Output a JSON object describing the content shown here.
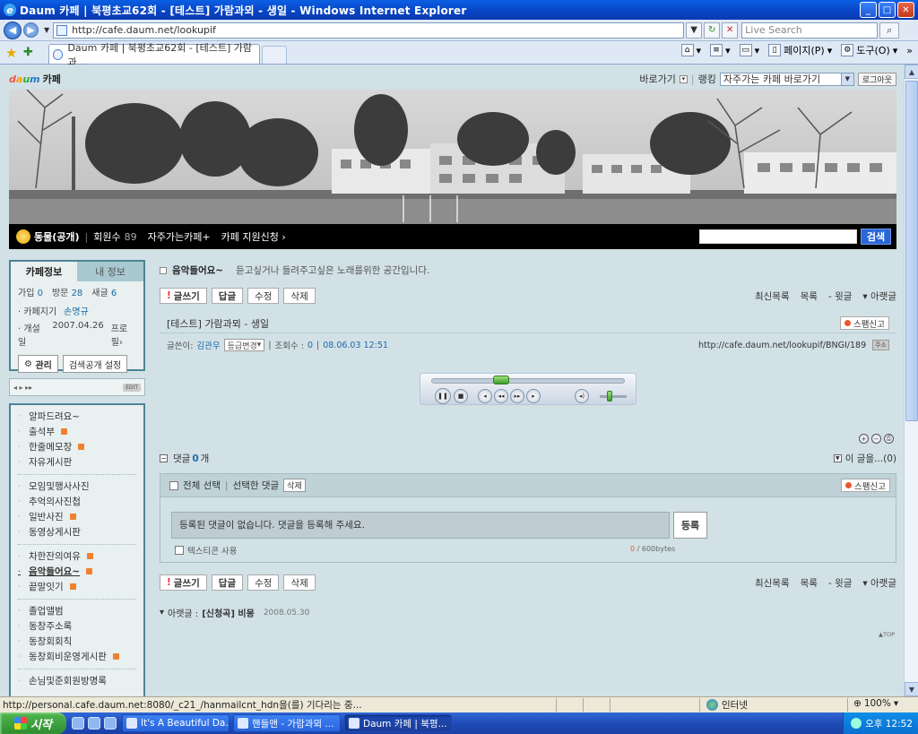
{
  "browser": {
    "window_title": "Daum 카페 | 북평초교62회 - [테스트] 가람과뫼 - 생일 - Windows Internet Explorer",
    "address": "http://cafe.daum.net/lookupif",
    "search_placeholder": "Live Search",
    "tab_title": "Daum 카페 | 북평초교62회 - [테스트] 가람과...",
    "cmd_page": "페이지(P)",
    "cmd_tools": "도구(O)",
    "cmd_more": "»",
    "status_text": "http://personal.cafe.daum.net:8080/_c21_/hanmailcnt_hdn을(를) 기다리는 중...",
    "zone": "인터넷",
    "zoom": "100%"
  },
  "cafe_top": {
    "logo_daum": [
      "d",
      "a",
      "u",
      "m"
    ],
    "logo_cafe": "카페",
    "shortcut_label": "바로가기",
    "ranking_label": "랭킹",
    "quick_select": "자주가는 카페 바로가기",
    "logout": "로그아웃"
  },
  "banner": {
    "cafe_name": "동물(공개)",
    "member_label": "회원수",
    "member_count": "89",
    "frequent": "자주가는카페",
    "frequent_mark": "+",
    "support": "카페 지원신청",
    "support_mark": "›",
    "search_button": "검색"
  },
  "info_box": {
    "tab_cafe": "카페정보",
    "tab_my": "내 정보",
    "join_label": "가입",
    "join_value": "0",
    "visit_label": "방문",
    "visit_value": "28",
    "posts_label": "새글",
    "posts_value": "6",
    "manager_label": "· 카페지기",
    "manager_value": "손명규",
    "opened_label": "· 개설일",
    "opened_value": "2007.04.26",
    "profile_label": "프로필",
    "profile_mark": "›",
    "manage_button": "관리",
    "search_setting_button": "검색공개 설정"
  },
  "player_box": {
    "controls": "◂ ▸ ▸▸",
    "edit": "EDIT"
  },
  "menu": {
    "groups": [
      [
        {
          "label": "알파드려요~",
          "new": false
        },
        {
          "label": "출석부",
          "new": true
        },
        {
          "label": "한줄메모장",
          "new": true
        },
        {
          "label": "자유게시판",
          "new": false
        }
      ],
      [
        {
          "label": "모임및행사사진",
          "new": false
        },
        {
          "label": "추억의사진첩",
          "new": false
        },
        {
          "label": "일반사진",
          "new": true
        },
        {
          "label": "동영상게시판",
          "new": false
        }
      ],
      [
        {
          "label": "차한잔의여유",
          "new": true
        },
        {
          "label": "음악들어요~",
          "new": true,
          "bold": true
        },
        {
          "label": "끝말잇기",
          "new": true
        }
      ],
      [
        {
          "label": "졸업앨범",
          "new": false
        },
        {
          "label": "동창주소록",
          "new": false
        },
        {
          "label": "동창회회칙",
          "new": false
        },
        {
          "label": "동창회비운영게시판",
          "new": true
        }
      ],
      [
        {
          "label": "손님및준회원방명록",
          "new": false
        }
      ]
    ]
  },
  "board": {
    "title": "음악들어요~",
    "description": "듣고싶거나 들려주고싶은 노래를위한 공간입니다."
  },
  "actions": {
    "write": "글쓰기",
    "write_mark": "!",
    "reply": "답글",
    "edit": "수정",
    "delete": "삭제",
    "list_latest": "최신목록",
    "list": "목록",
    "prev": "윗글",
    "next": "아랫글"
  },
  "post": {
    "title": "[테스트] 가람과뫼 - 생일",
    "spam": "스팸신고",
    "author_label": "글쓴이:",
    "author": "김관우",
    "grade_button": "등급변경",
    "views_label": "조회수 :",
    "views": "0",
    "date": "08.06.03 12:51",
    "url": "http://cafe.daum.net/lookupif/BNGI/189",
    "url_button": "주소"
  },
  "media_player": {
    "position_fraction": 0.35,
    "volume_fraction": 0.35
  },
  "comments": {
    "label": "댓글",
    "count": "0",
    "count_unit": "개",
    "this_post": "이 글을...(0)",
    "select_all": "전체 선택",
    "bar_sep": "|",
    "selected_label": "선택한 댓글",
    "delete": "삭제",
    "spam": "스팸신고",
    "input_placeholder": "등록된 댓글이 없습니다. 댓글을 등록해 주세요.",
    "submit": "등록",
    "emoticon": "텍스티콘 사용",
    "bytes_current": "0",
    "bytes_max": " / 600bytes"
  },
  "prev_post": {
    "label": "아랫글 :",
    "title": "[신청곡] 비몽",
    "date": "2008.05.30"
  },
  "top_link": "▲TOP",
  "taskbar": {
    "start": "시작",
    "tasks": [
      {
        "label": "It's A Beautiful Da...",
        "active": false
      },
      {
        "label": "핸들맨 - 가람과뫼 ...",
        "active": false
      },
      {
        "label": "Daum 카페 | 북평...",
        "active": true
      }
    ],
    "clock": "오후 12:52"
  }
}
